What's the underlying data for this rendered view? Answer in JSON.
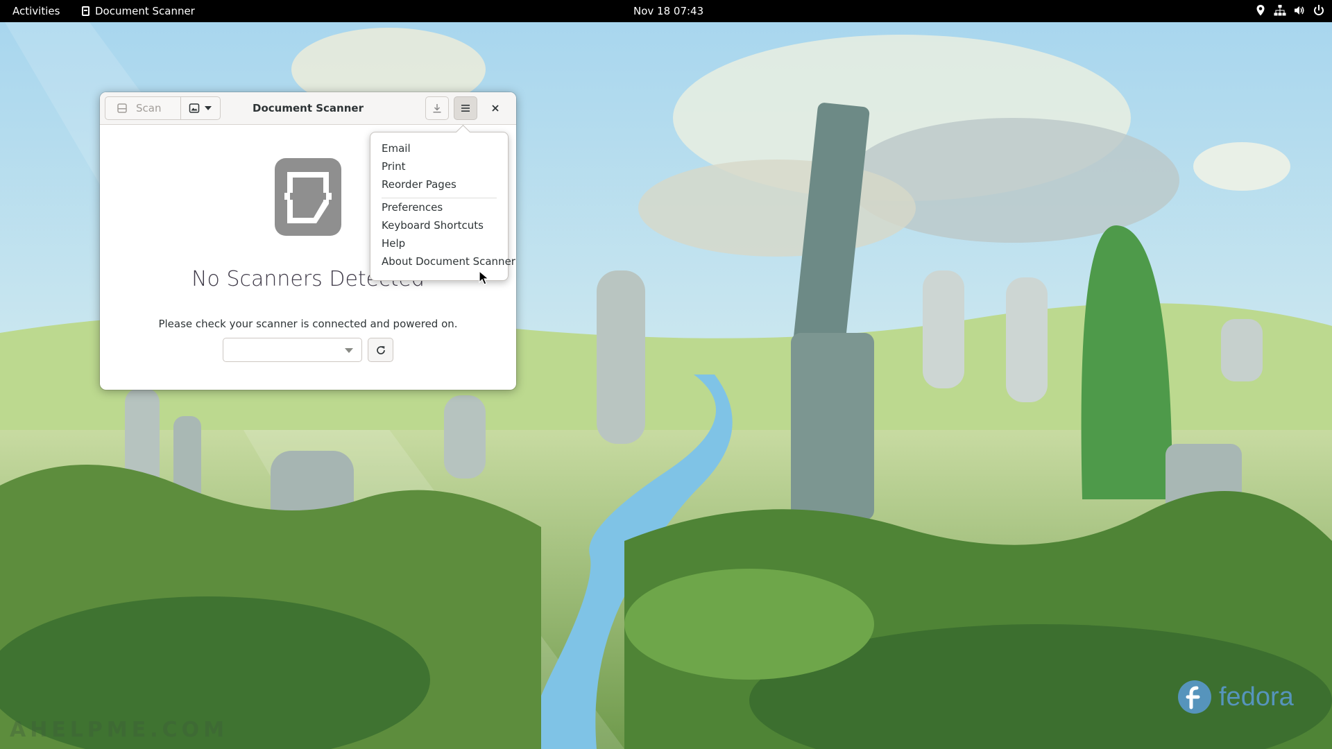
{
  "topbar": {
    "activities": "Activities",
    "app_name": "Document Scanner",
    "clock": "Nov 18  07:43",
    "tray_icons": [
      "location-icon",
      "network-icon",
      "volume-icon",
      "power-icon"
    ]
  },
  "window": {
    "title": "Document Scanner",
    "scan_label": "Scan",
    "empty_state": {
      "title": "No Scanners Detected",
      "subtitle": "Please check your scanner is connected and powered on.",
      "device_selected": ""
    }
  },
  "menu": {
    "group1": [
      "Email",
      "Print",
      "Reorder Pages"
    ],
    "group2": [
      "Preferences",
      "Keyboard Shortcuts",
      "Help",
      "About Document Scanner"
    ]
  },
  "watermarks": {
    "brand": "fedora",
    "site": "AHELPME.COM"
  },
  "colors": {
    "topbar_bg": "#000000",
    "window_bg": "#ffffff",
    "headerbar_bg": "#f6f5f4",
    "fedora_blue": "#5b9bd5"
  }
}
